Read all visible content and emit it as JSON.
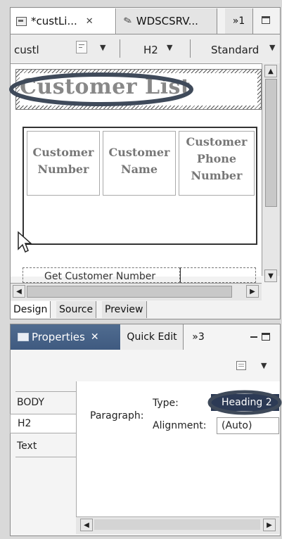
{
  "editor": {
    "tabs": [
      {
        "label": "*custLi...",
        "icon": "page-icon",
        "close": "✕"
      },
      {
        "label": "WDSCSRV...",
        "icon": "pencil-icon"
      },
      {
        "label": "»1"
      }
    ],
    "toolbar": {
      "field": "custl",
      "paragraph_style": "H2",
      "font": "Standard"
    },
    "canvas": {
      "heading": "Customer List",
      "table_headers": [
        "Customer Number",
        "Customer Name",
        "Customer Phone Number"
      ],
      "button_label": "Get Customer Number"
    },
    "view_tabs": [
      "Design",
      "Source",
      "Preview"
    ]
  },
  "properties": {
    "tabs": [
      {
        "label": "Properties",
        "close": "✕"
      },
      {
        "label": "Quick Edit"
      },
      {
        "label": "»3"
      }
    ],
    "left_list": [
      "BODY",
      "H2",
      "Text"
    ],
    "paragraph_label": "Paragraph:",
    "type_label": "Type:",
    "type_value": "Heading 2",
    "alignment_label": "Alignment:",
    "alignment_value": "(Auto)"
  },
  "colors": {
    "highlight_ellipse": "#3f4a5a",
    "selected_type": "#2c3a55"
  }
}
